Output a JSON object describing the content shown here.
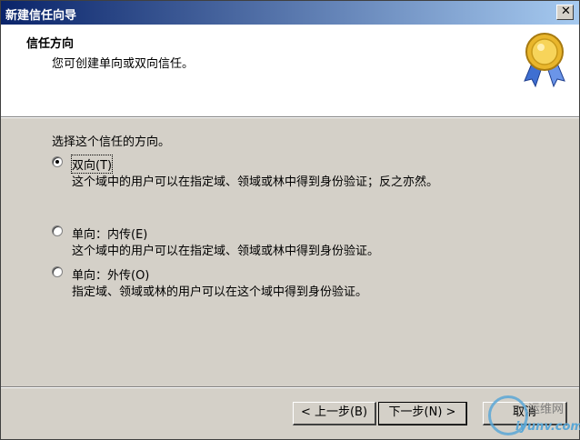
{
  "window": {
    "title": "新建信任向导",
    "close_label": "✕"
  },
  "header": {
    "title": "信任方向",
    "subtitle": "您可创建单向或双向信任。",
    "icon": "award-medal-icon"
  },
  "content": {
    "prompt": "选择这个信任的方向。",
    "options": [
      {
        "label": "双向(T)",
        "description": "这个域中的用户可以在指定域、领域或林中得到身份验证；反之亦然。",
        "selected": true
      },
      {
        "label": "单向：内传(E)",
        "description": "这个域中的用户可以在指定域、领域或林中得到身份验证。",
        "selected": false
      },
      {
        "label": "单向：外传(O)",
        "description": "指定域、领域或林的用户可以在这个域中得到身份验证。",
        "selected": false
      }
    ]
  },
  "buttons": {
    "back": "< 上一步(B)",
    "next": "下一步(N) >",
    "cancel": "取消"
  },
  "watermark": {
    "top": "运维网",
    "bottom": "iyunv.com"
  }
}
